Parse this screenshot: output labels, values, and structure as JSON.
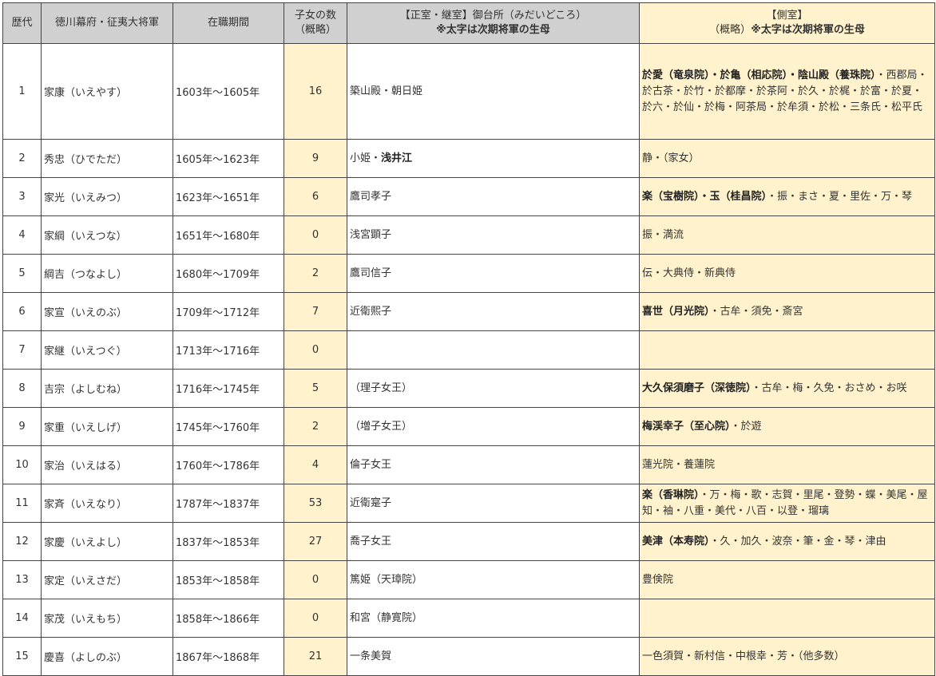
{
  "header": {
    "col_no": "歴代",
    "col_name": "徳川幕府・征夷大将軍",
    "col_period": "在職期間",
    "col_children_1": "子女の数",
    "col_children_2": "（概略）",
    "col_main_1": "【正室・継室】御台所（みだいどころ）",
    "col_main_2": "※太字は次期将軍の生母",
    "col_side_1": "【側室】",
    "col_side_2a": "（概略）",
    "col_side_2b": "※太字は次期将軍の生母"
  },
  "rows": [
    {
      "no": "1",
      "name": "家康（いえやす）",
      "period": "1603年〜1605年",
      "children": "16",
      "main": [
        {
          "t": "築山殿・朝日姫",
          "b": false
        }
      ],
      "side": [
        {
          "t": "於愛（竜泉院）・於亀（相応院）・",
          "b": true
        },
        {
          "t": "陰山殿（養珠院）",
          "b": true
        },
        {
          "t": "・西郡局・於古茶・於竹・於都摩・於茶阿・於久・於梶・於富・於夏・於六・於仙・於梅・阿茶局・於牟須・於松・三条氏・松平氏",
          "b": false
        }
      ]
    },
    {
      "no": "2",
      "name": "秀忠（ひでただ）",
      "period": "1605年〜1623年",
      "children": "9",
      "main": [
        {
          "t": "小姫・",
          "b": false
        },
        {
          "t": "浅井江",
          "b": true
        }
      ],
      "side": [
        {
          "t": "静・（家女）",
          "b": false
        }
      ]
    },
    {
      "no": "3",
      "name": "家光（いえみつ）",
      "period": "1623年〜1651年",
      "children": "6",
      "main": [
        {
          "t": "鷹司孝子",
          "b": false
        }
      ],
      "side": [
        {
          "t": "楽（宝樹院）・玉（桂昌院）",
          "b": true
        },
        {
          "t": "・振・まさ・夏・里佐・万・琴",
          "b": false
        }
      ]
    },
    {
      "no": "4",
      "name": "家綱（いえつな）",
      "period": "1651年〜1680年",
      "children": "0",
      "main": [
        {
          "t": "浅宮顕子",
          "b": false
        }
      ],
      "side": [
        {
          "t": "振・満流",
          "b": false
        }
      ]
    },
    {
      "no": "5",
      "name": "綱吉（つなよし）",
      "period": "1680年〜1709年",
      "children": "2",
      "main": [
        {
          "t": "鷹司信子",
          "b": false
        }
      ],
      "side": [
        {
          "t": "伝・大典侍・新典侍",
          "b": false
        }
      ]
    },
    {
      "no": "6",
      "name": "家宣（いえのぶ）",
      "period": "1709年〜1712年",
      "children": "7",
      "main": [
        {
          "t": "近衛熙子",
          "b": false
        }
      ],
      "side": [
        {
          "t": "喜世（月光院）",
          "b": true
        },
        {
          "t": "・古牟・須免・斎宮",
          "b": false
        }
      ]
    },
    {
      "no": "7",
      "name": "家継（いえつぐ）",
      "period": "1713年〜1716年",
      "children": "0",
      "main": [],
      "side": []
    },
    {
      "no": "8",
      "name": "吉宗（よしむね）",
      "period": "1716年〜1745年",
      "children": "5",
      "main": [
        {
          "t": "（理子女王）",
          "b": false
        }
      ],
      "side": [
        {
          "t": "大久保須磨子（深徳院）",
          "b": true
        },
        {
          "t": "・古牟・梅・久免・おさめ・お咲",
          "b": false
        }
      ]
    },
    {
      "no": "9",
      "name": "家重（いえしげ）",
      "period": "1745年〜1760年",
      "children": "2",
      "main": [
        {
          "t": "（増子女王）",
          "b": false
        }
      ],
      "side": [
        {
          "t": "梅渓幸子（至心院）",
          "b": true
        },
        {
          "t": "・於遊",
          "b": false
        }
      ]
    },
    {
      "no": "10",
      "name": "家治（いえはる）",
      "period": "1760年〜1786年",
      "children": "4",
      "main": [
        {
          "t": "倫子女王",
          "b": false
        }
      ],
      "side": [
        {
          "t": "蓮光院・養蓮院",
          "b": false
        }
      ]
    },
    {
      "no": "11",
      "name": "家斉（いえなり）",
      "period": "1787年〜1837年",
      "children": "53",
      "main": [
        {
          "t": "近衛寔子",
          "b": false
        }
      ],
      "side": [
        {
          "t": "楽（香琳院）",
          "b": true
        },
        {
          "t": "・万・梅・歌・志賀・里尾・登勢・蝶・美尾・屋知・袖・八重・美代・八百・以登・瑠璃",
          "b": false
        }
      ]
    },
    {
      "no": "12",
      "name": "家慶（いえよし）",
      "period": "1837年〜1853年",
      "children": "27",
      "main": [
        {
          "t": "喬子女王",
          "b": false
        }
      ],
      "side": [
        {
          "t": "美津（本寿院）",
          "b": true
        },
        {
          "t": "・久・加久・波奈・筆・金・琴・津由",
          "b": false
        }
      ]
    },
    {
      "no": "13",
      "name": "家定（いえさだ）",
      "period": "1853年〜1858年",
      "children": "0",
      "main": [
        {
          "t": "篤姫（天璋院）",
          "b": false
        }
      ],
      "side": [
        {
          "t": "豊倹院",
          "b": false
        }
      ]
    },
    {
      "no": "14",
      "name": "家茂（いえもち）",
      "period": "1858年〜1866年",
      "children": "0",
      "main": [
        {
          "t": "和宮（静寛院）",
          "b": false
        }
      ],
      "side": []
    },
    {
      "no": "15",
      "name": "慶喜（よしのぶ）",
      "period": "1867年〜1868年",
      "children": "21",
      "main": [
        {
          "t": "一条美賀",
          "b": false
        }
      ],
      "side": [
        {
          "t": "一色須賀・新村信・中根幸・芳・（他多数）",
          "b": false
        }
      ]
    }
  ]
}
